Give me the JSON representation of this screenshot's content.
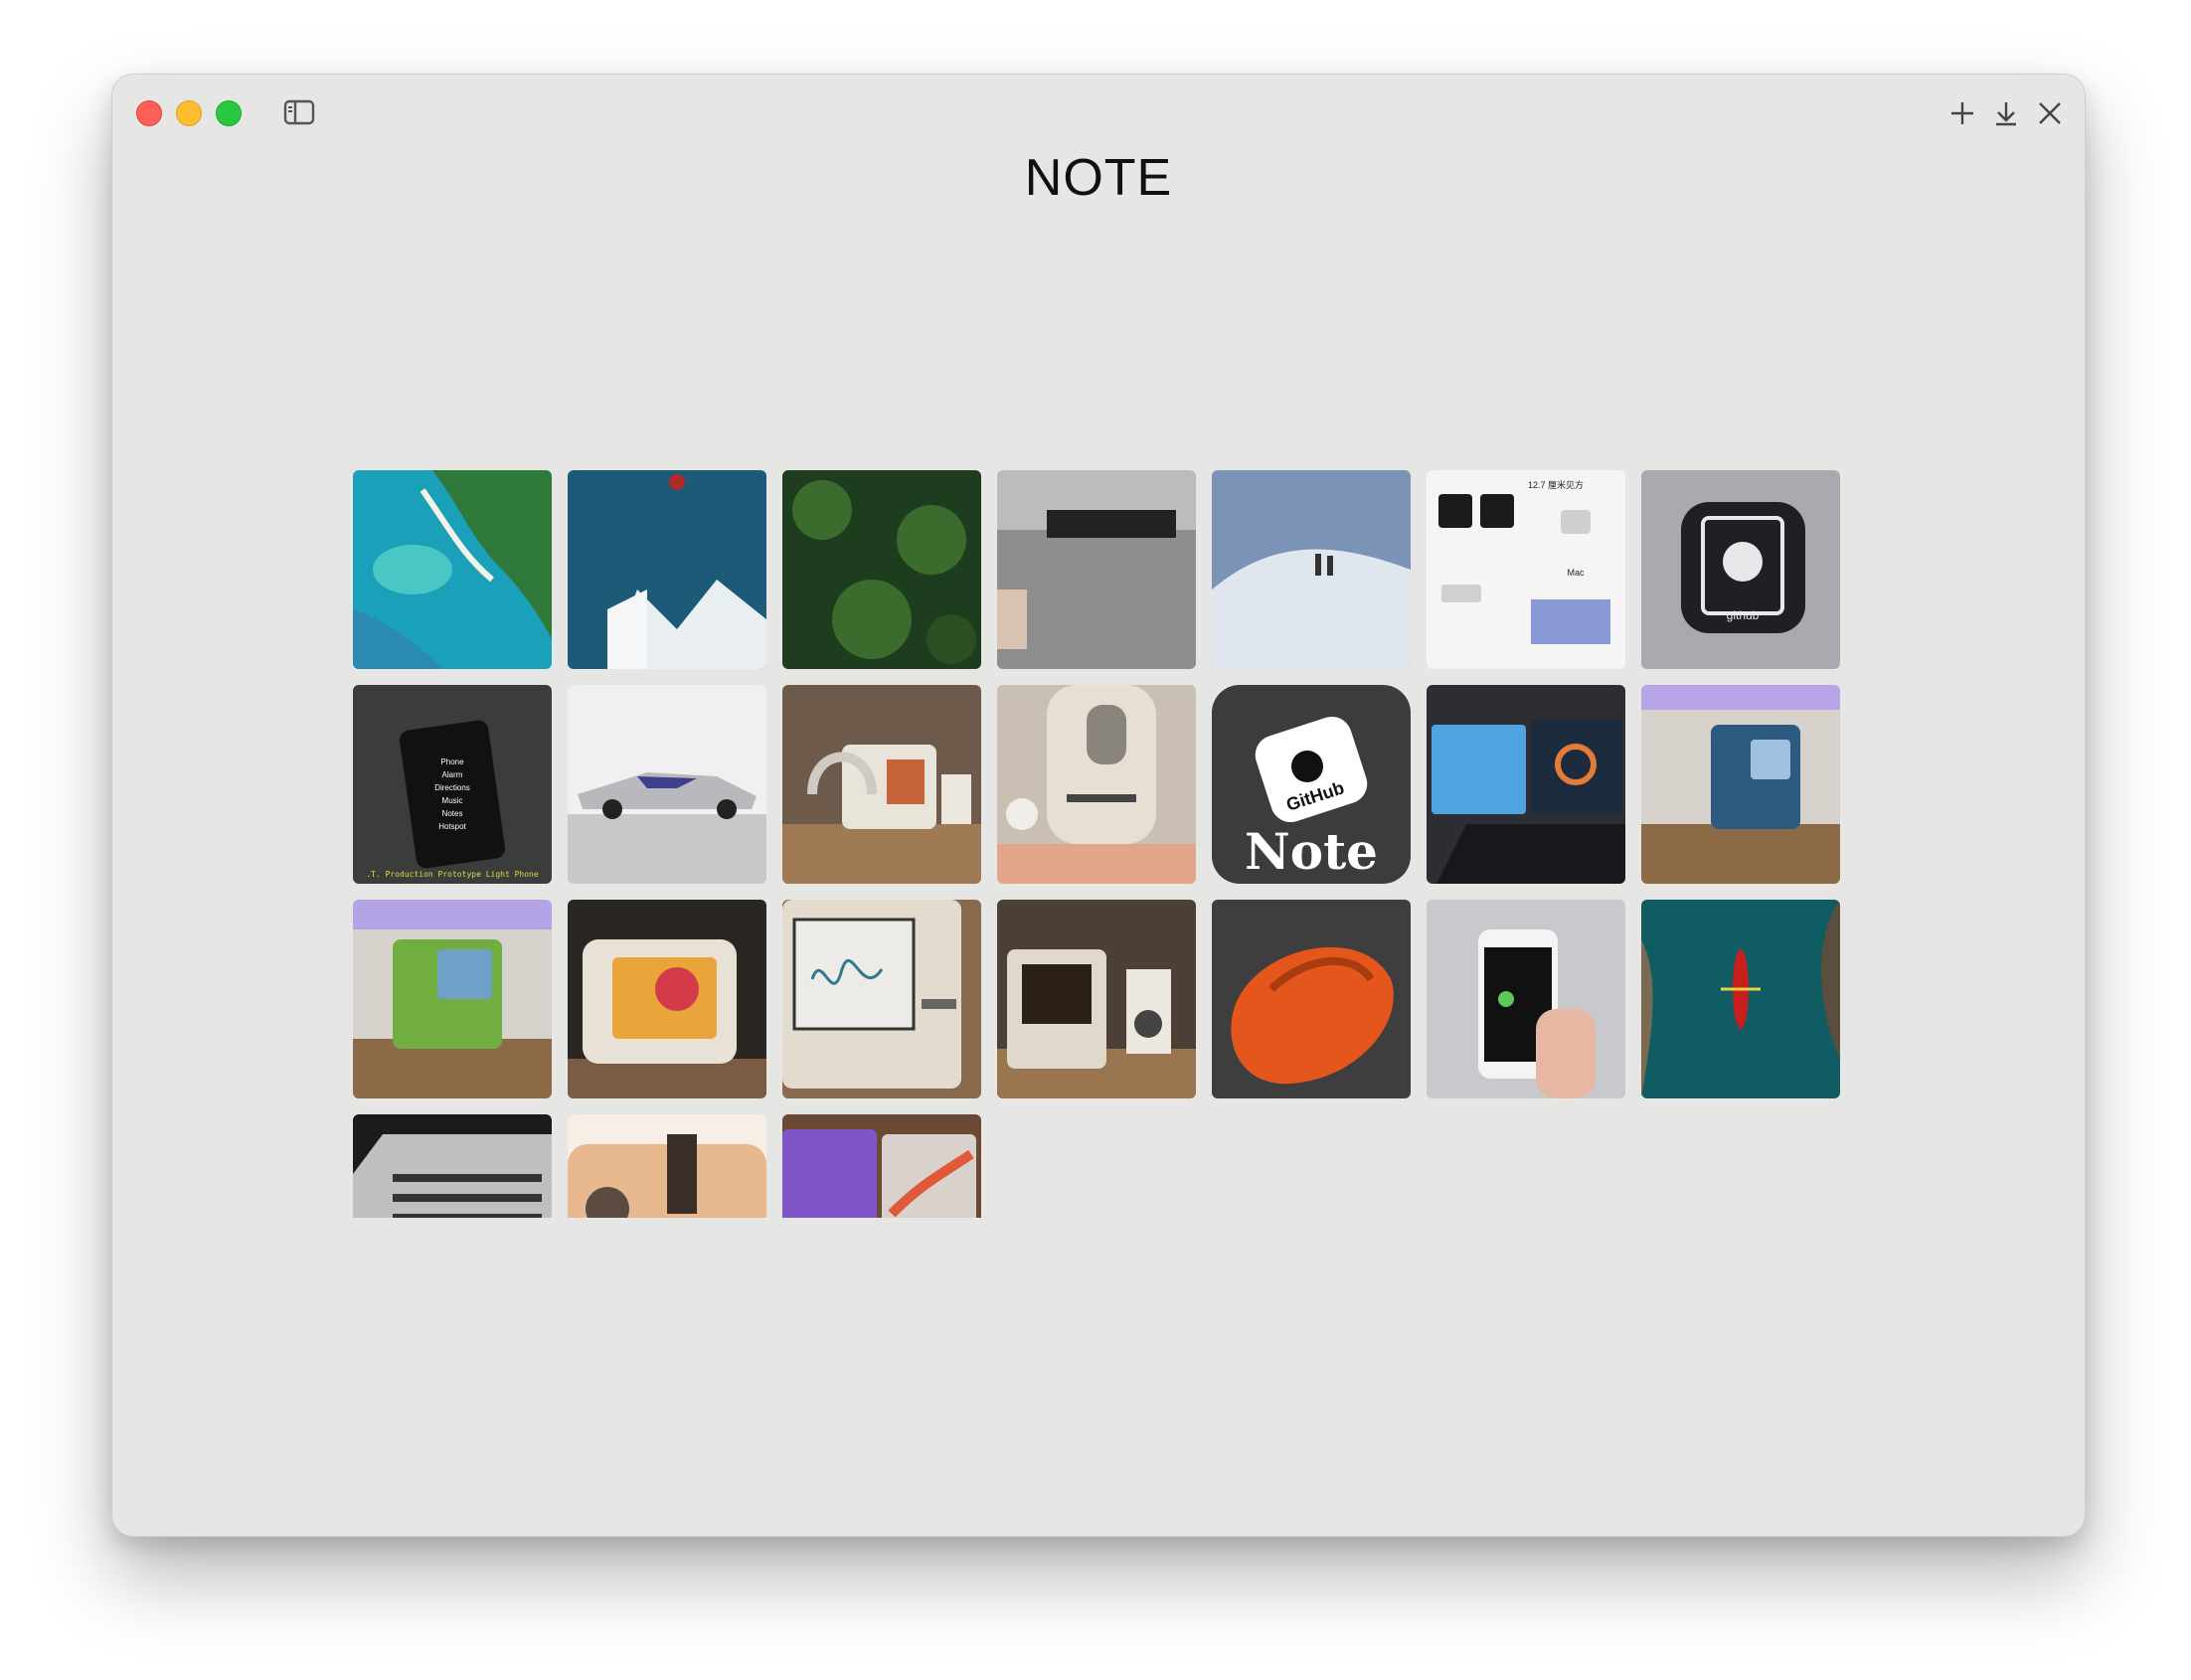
{
  "window": {
    "title": "NOTE",
    "toolbar_icons": [
      "sidebar-toggle-icon",
      "plus-icon",
      "download-icon",
      "close-icon"
    ]
  },
  "gallery": {
    "items": [
      {
        "name": "coastline-aerial",
        "colors": [
          "#1aa0b8",
          "#2f7a3a"
        ]
      },
      {
        "name": "ski-jump-mountain",
        "colors": [
          "#1c5a78",
          "#e8eef2"
        ]
      },
      {
        "name": "forest-top-view",
        "colors": [
          "#1e3d1f",
          "#3b6b2d"
        ]
      },
      {
        "name": "grey-device-label",
        "colors": [
          "#bcbcbc",
          "#222222"
        ]
      },
      {
        "name": "snow-hikers",
        "colors": [
          "#dfe6ee",
          "#7b93b5"
        ]
      },
      {
        "name": "mac-mini-infographic",
        "colors": [
          "#f5f5f5",
          "#1a1a1a"
        ],
        "texts": [
          "12.7 厘米见方",
          "Mac"
        ]
      },
      {
        "name": "github-app-icon",
        "colors": [
          "#a9aab0",
          "#1f1f24"
        ],
        "texts": [
          "github"
        ]
      },
      {
        "name": "hand-holding-phone-menu",
        "colors": [
          "#3a3d3c",
          "#111111"
        ],
        "texts": [
          "Phone",
          "Alarm",
          "Directions",
          "Music",
          "Notes",
          "Hotspot",
          ".T. Production Prototype Light Phone"
        ]
      },
      {
        "name": "concept-car",
        "colors": [
          "#f0f0f0",
          "#3c3f8c"
        ]
      },
      {
        "name": "retro-computer-headphones",
        "colors": [
          "#a07a55",
          "#e9e4da"
        ]
      },
      {
        "name": "label-printer-cat",
        "colors": [
          "#c9bfb2",
          "#e7dfd3"
        ]
      },
      {
        "name": "github-note-logo",
        "colors": [
          "#3c3c3c",
          "#ffffff"
        ],
        "texts": [
          "GitHub",
          "Note"
        ]
      },
      {
        "name": "dual-screen-laptop",
        "colors": [
          "#2c2e33",
          "#4fa3e0"
        ]
      },
      {
        "name": "blue-cube-computer",
        "colors": [
          "#8c6a45",
          "#2c5a80"
        ]
      },
      {
        "name": "green-cube-computer",
        "colors": [
          "#8c6a45",
          "#6fae3f"
        ]
      },
      {
        "name": "retro-tv-computer",
        "colors": [
          "#2a2623",
          "#e8e1d6"
        ]
      },
      {
        "name": "retro-mac-drawing",
        "colors": [
          "#8a6a4e",
          "#e3dbcd"
        ]
      },
      {
        "name": "retro-mac-speakers",
        "colors": [
          "#9a7650",
          "#e0d8cb"
        ]
      },
      {
        "name": "orange-mouse",
        "colors": [
          "#3e3e3e",
          "#e4561c"
        ]
      },
      {
        "name": "hand-holding-iphone",
        "colors": [
          "#c9c8cc",
          "#111111"
        ]
      },
      {
        "name": "kayak-aerial",
        "colors": [
          "#0f5c62",
          "#c81e1e"
        ]
      },
      {
        "name": "silver-mini-pc",
        "colors": [
          "#1b1b1b",
          "#bfbfbf"
        ]
      },
      {
        "name": "peach-gadget",
        "colors": [
          "#f7efe6",
          "#e8b98f"
        ]
      },
      {
        "name": "tablets-desk",
        "colors": [
          "#6a4a35",
          "#7f56c7"
        ]
      }
    ]
  }
}
